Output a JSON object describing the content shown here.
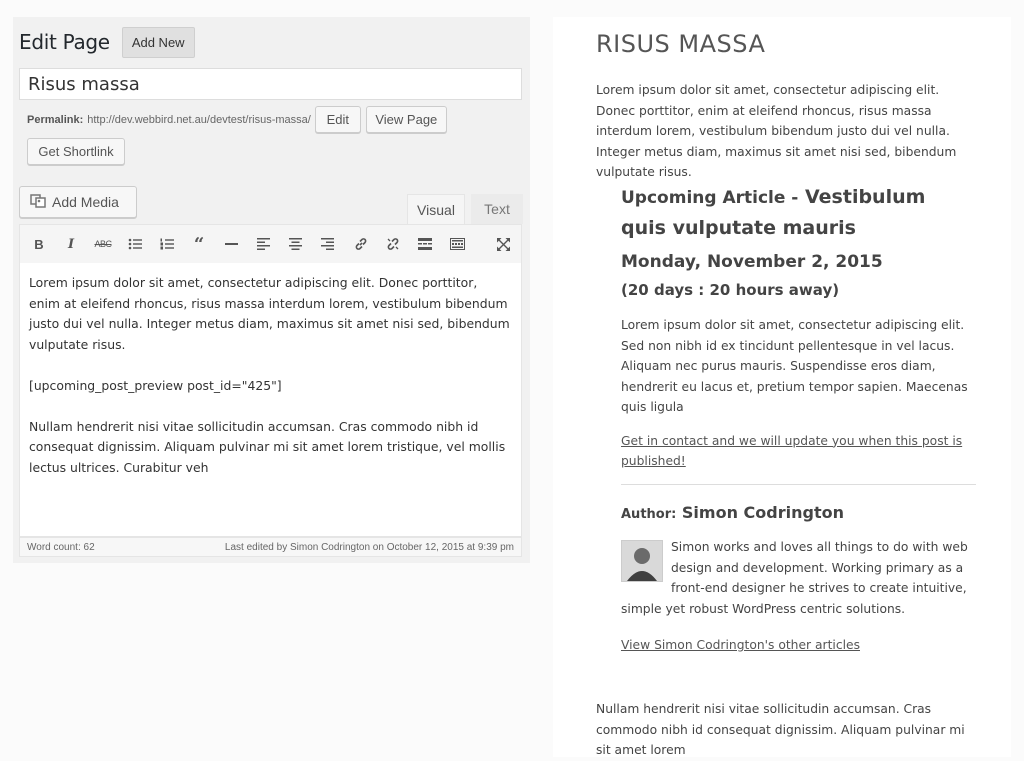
{
  "editor": {
    "page_title": "Edit Page",
    "add_new_label": "Add New",
    "post_title": "Risus massa",
    "permalink_label": "Permalink:",
    "permalink_url": "http://dev.webbird.net.au/devtest/risus-massa/",
    "permalink_edit_label": "Edit",
    "view_page_label": "View Page",
    "shortlink_label": "Get Shortlink",
    "add_media_label": "Add Media",
    "tab_visual": "Visual",
    "tab_text": "Text",
    "toolbar_icons": [
      "bold-icon",
      "italic-icon",
      "strikethrough-icon",
      "bullet-list-icon",
      "numbered-list-icon",
      "blockquote-icon",
      "horizontal-rule-icon",
      "align-left-icon",
      "align-center-icon",
      "align-right-icon",
      "link-icon",
      "unlink-icon",
      "read-more-icon",
      "toolbar-toggle-icon",
      "fullscreen-icon"
    ],
    "content": {
      "p1": "Lorem ipsum dolor sit amet, consectetur adipiscing elit. Donec porttitor, enim at eleifend rhoncus, risus massa interdum lorem, vestibulum bibendum justo dui vel nulla. Integer metus diam, maximus sit amet nisi sed, bibendum vulputate risus.",
      "shortcode": "[upcoming_post_preview post_id=\"425\"]",
      "p2": "Nullam hendrerit nisi vitae sollicitudin accumsan. Cras commodo nibh id consequat dignissim. Aliquam pulvinar mi sit amet lorem tristique, vel mollis lectus ultrices. Curabitur veh"
    },
    "word_count": "Word count: 62",
    "last_edited": "Last edited by Simon Codrington on October 12, 2015 at 9:39 pm"
  },
  "preview": {
    "title": "RISUS MASSA",
    "intro": "Lorem ipsum dolor sit amet, consectetur adipiscing elit. Donec porttitor, enim at eleifend rhoncus, risus massa interdum lorem, vestibulum bibendum justo dui vel nulla. Integer metus diam, maximus sit amet nisi sed, bibendum vulputate risus.",
    "upcoming": {
      "prefix": "Upcoming Article -",
      "article_title": "Vestibulum quis vulputate mauris",
      "date": "Monday, November 2, 2015",
      "countdown": "(20 days : 20 hours away)",
      "excerpt": "Lorem ipsum dolor sit amet, consectetur adipiscing elit. Sed non nibh id ex tincidunt pellentesque in vel lacus. Aliquam nec purus mauris. Suspendisse eros diam, hendrerit eu lacus et, pretium tempor sapien. Maecenas quis ligula",
      "contact_link": "Get in contact and we will update you when this post is published!"
    },
    "author": {
      "label": "Author:",
      "name": "Simon Codrington",
      "bio": "Simon works and loves all things to do with web design and development. Working primary as a front-end designer he strives to create intuitive, simple yet robust WordPress centric solutions.",
      "link": "View Simon Codrington's other articles"
    },
    "outro": "Nullam hendrerit nisi vitae sollicitudin accumsan. Cras commodo nibh id consequat dignissim. Aliquam pulvinar mi sit amet lorem"
  },
  "colors": {
    "panel_bg": "#f1f1f1",
    "link": "#555555",
    "text": "#444444"
  }
}
